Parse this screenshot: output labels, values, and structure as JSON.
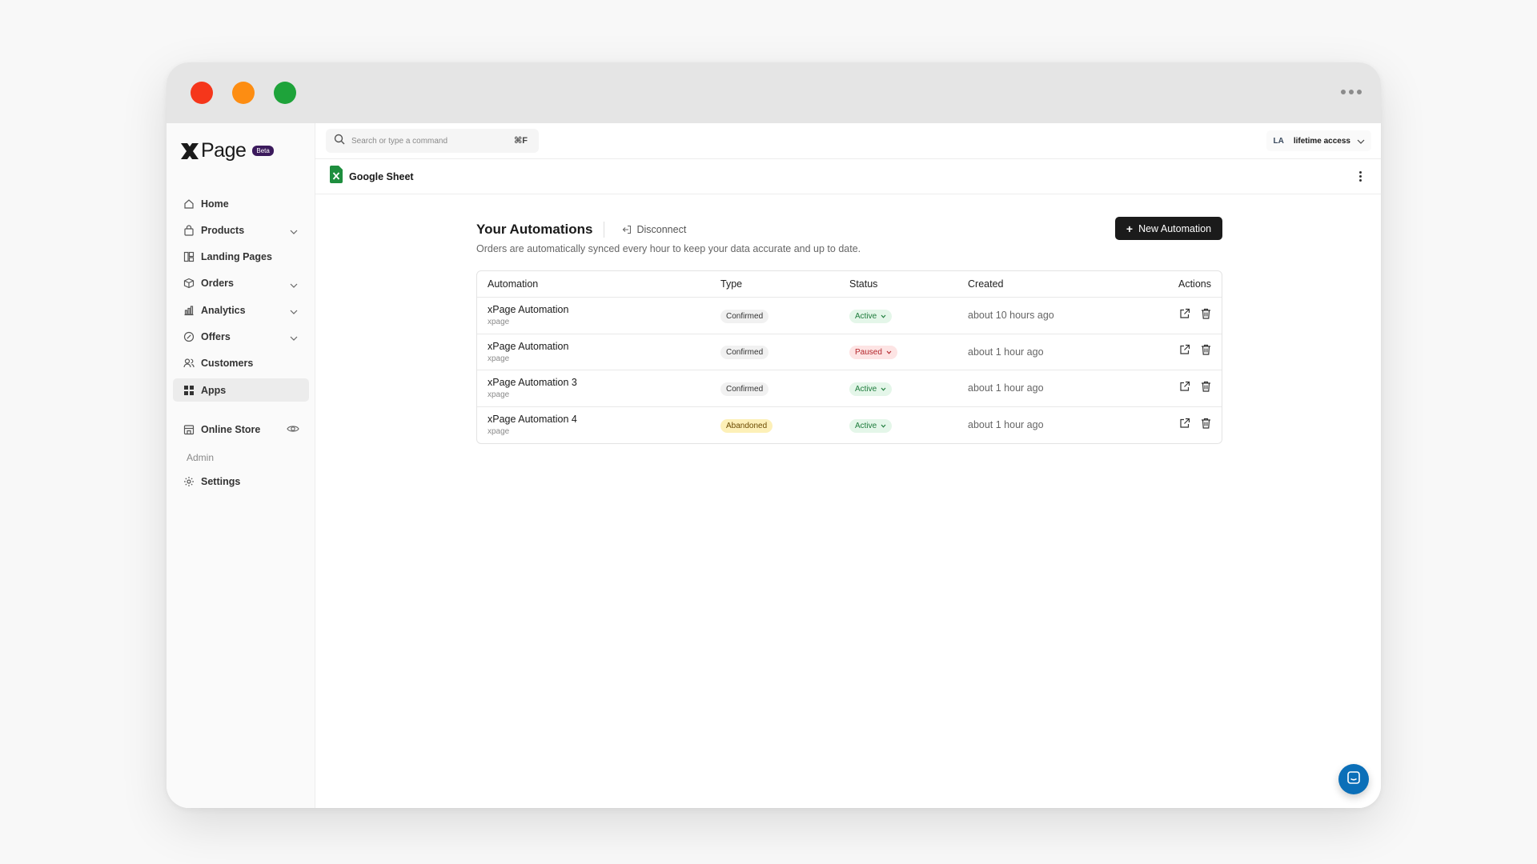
{
  "app": {
    "logo_mark": "X",
    "logo_word": "Page",
    "beta_badge": "Beta"
  },
  "sidebar": {
    "items": [
      {
        "label": "Home",
        "icon": "home-icon",
        "expandable": false,
        "active": false
      },
      {
        "label": "Products",
        "icon": "bag-icon",
        "expandable": true,
        "active": false
      },
      {
        "label": "Landing Pages",
        "icon": "layout-icon",
        "expandable": false,
        "active": false
      },
      {
        "label": "Orders",
        "icon": "box-icon",
        "expandable": true,
        "active": false
      },
      {
        "label": "Analytics",
        "icon": "bar-chart-icon",
        "expandable": true,
        "active": false
      },
      {
        "label": "Offers",
        "icon": "discount-icon",
        "expandable": true,
        "active": false
      },
      {
        "label": "Customers",
        "icon": "users-icon",
        "expandable": false,
        "active": false
      },
      {
        "label": "Apps",
        "icon": "grid-icon",
        "expandable": false,
        "active": true
      }
    ],
    "store_label": "Online Store",
    "admin_section_label": "Admin",
    "settings_label": "Settings"
  },
  "topbar": {
    "search_placeholder": "Search or type a command",
    "shortcut": "⌘F",
    "account_initials": "LA",
    "account_plan": "lifetime access"
  },
  "subbar": {
    "title": "Google Sheet"
  },
  "content": {
    "heading": "Your Automations",
    "disconnect_label": "Disconnect",
    "subtext": "Orders are automatically synced every hour to keep your data accurate and up to date.",
    "new_button_label": "New Automation"
  },
  "table": {
    "headers": [
      "Automation",
      "Type",
      "Status",
      "Created",
      "Actions"
    ],
    "rows": [
      {
        "name": "xPage Automation",
        "sub": "xpage",
        "type": "Confirmed",
        "status": "Active",
        "created": "about 10 hours ago"
      },
      {
        "name": "xPage Automation",
        "sub": "xpage",
        "type": "Confirmed",
        "status": "Paused",
        "created": "about 1 hour ago"
      },
      {
        "name": "xPage Automation 3",
        "sub": "xpage",
        "type": "Confirmed",
        "status": "Active",
        "created": "about 1 hour ago"
      },
      {
        "name": "xPage Automation 4",
        "sub": "xpage",
        "type": "Abandoned",
        "status": "Active",
        "created": "about 1 hour ago"
      }
    ]
  },
  "colors": {
    "accent": "#1b1b1b",
    "active_status": "#1c7a3a",
    "paused_status": "#b3262b",
    "abandoned_badge": "#fdf0b8",
    "sheet_green": "#1e8e3e",
    "chat_blue": "#0b6fb8"
  }
}
